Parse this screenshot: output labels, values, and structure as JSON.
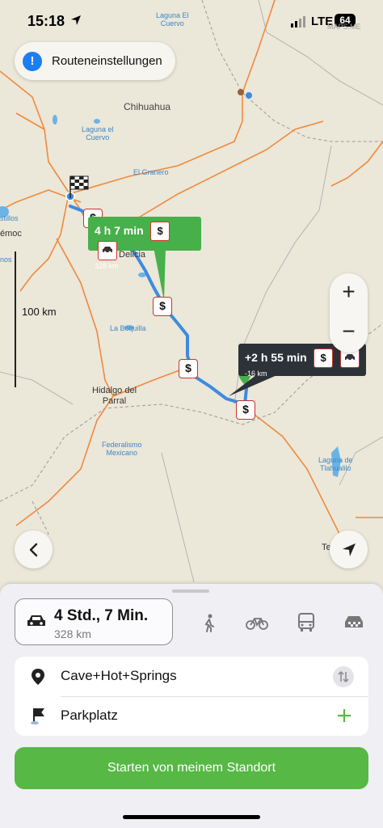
{
  "status_bar": {
    "time": "15:18",
    "network": "LTE",
    "battery": "64",
    "brand": "MAPS.ME"
  },
  "route_settings": {
    "label": "Routeneinstellungen"
  },
  "map": {
    "labels": {
      "laguna_el_cuervo_top": "Laguna El\nCuervo",
      "chihuahua": "Chihuahua",
      "laguna_el_cuervo": "Laguna el\nCuervo",
      "el_granero": "El Granero",
      "delicias": "Delicia",
      "la_boquilla": "La Boquilla",
      "hidalgo": "Hidalgo del\nParral",
      "federalismo": "Federalismo\nMexicano",
      "laguna_tlahualilo": "Laguna de\nTlahualilo",
      "cuauhtemoc_partial": "émoc",
      "left_partial_1": "stillos",
      "left_partial_2": "nos",
      "torreon_partial": "Te"
    },
    "scale": "100 km",
    "route_main": {
      "time": "4 h 7 min",
      "distance": "328 km"
    },
    "route_alt": {
      "time": "+2 h 55 min",
      "distance": "-16 km"
    },
    "toll_symbol": "$",
    "zoom_in": "+",
    "zoom_out": "−"
  },
  "sheet": {
    "selected_mode": {
      "duration": "4 Std., 7 Min.",
      "distance": "328 km"
    },
    "modes": [
      "car-icon",
      "walk-icon",
      "bike-icon",
      "bus-icon",
      "taxi-icon"
    ],
    "stops": [
      {
        "label": "Cave+Hot+Springs",
        "icon": "pin-icon",
        "action": "swap-icon"
      },
      {
        "label": "Parkplatz",
        "icon": "flag-icon",
        "action": "add-icon"
      }
    ],
    "start_button": "Starten von meinem Standort"
  },
  "colors": {
    "accent_green": "#57b846",
    "route_blue": "#3d8be0",
    "toll_red": "#c9342e"
  }
}
